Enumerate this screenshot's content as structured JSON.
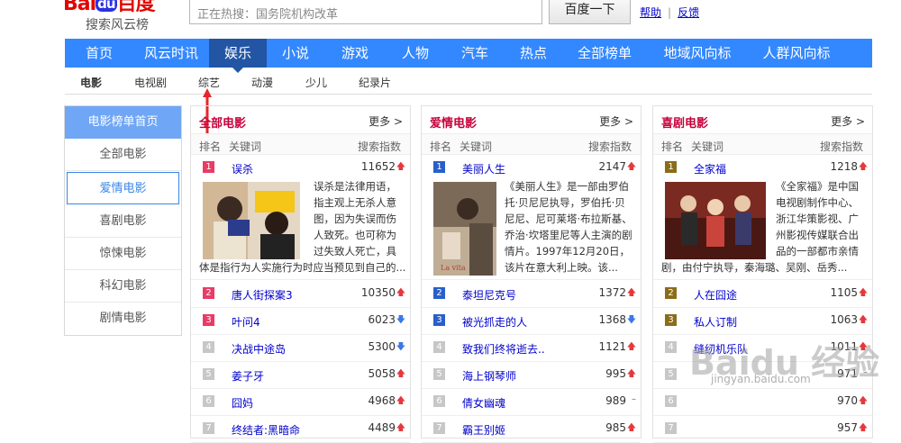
{
  "header": {
    "logo_main": "Bai",
    "logo_du": "du",
    "logo_cn": "百度",
    "logo_sub": "搜索风云榜",
    "search_placeholder": "正在热搜：国务院机构改革",
    "search_button": "百度一下",
    "help_link": "帮助",
    "feedback_link": "反馈"
  },
  "nav": {
    "items": [
      "首页",
      "风云时讯",
      "娱乐",
      "小说",
      "游戏",
      "人物",
      "汽车",
      "热点",
      "全部榜单",
      "地域风向标",
      "人群风向标"
    ],
    "active": "娱乐"
  },
  "subnav": {
    "items": [
      "电影",
      "电视剧",
      "综艺",
      "动漫",
      "少儿",
      "纪录片"
    ],
    "active": "电影"
  },
  "sidebar": {
    "header": "电影榜单首页",
    "items": [
      "全部电影",
      "爱情电影",
      "喜剧电影",
      "惊悚电影",
      "科幻电影",
      "剧情电影"
    ],
    "selected": "爱情电影"
  },
  "columns": {
    "rank": "排名",
    "keyword": "关键词",
    "index": "搜索指数",
    "more": "更多 >"
  },
  "panels": [
    {
      "title": "全部电影",
      "featured": {
        "rank": "1",
        "name": "误杀",
        "value": "11652",
        "trend": "up",
        "desc": "误杀是法律用语，指主观上无杀人意图，因为失误而伤人致死。也可称为过失致人死亡，具",
        "desc2": "体是指行为人实施行为时应当预见到自己的..."
      },
      "rows": [
        {
          "rank": "2",
          "name": "唐人街探案3",
          "value": "10350",
          "trend": "up"
        },
        {
          "rank": "3",
          "name": "叶问4",
          "value": "6023",
          "trend": "down"
        },
        {
          "rank": "4",
          "name": "决战中途岛",
          "value": "5300",
          "trend": "down"
        },
        {
          "rank": "5",
          "name": "姜子牙",
          "value": "5058",
          "trend": "up"
        },
        {
          "rank": "6",
          "name": "囧妈",
          "value": "4968",
          "trend": "up"
        },
        {
          "rank": "7",
          "name": "终结者:黑暗命",
          "value": "4489",
          "trend": "up"
        }
      ]
    },
    {
      "title": "爱情电影",
      "featured": {
        "rank": "1",
        "name": "美丽人生",
        "value": "2147",
        "trend": "up",
        "desc": "《美丽人生》是一部由罗伯托·贝尼尼执导，罗伯托·贝尼尼、尼可莱塔·布拉斯基、乔治·坎塔里尼等人主演的剧情片。1997年12月20日，该片在意大利上映。该...",
        "desc2": ""
      },
      "rows": [
        {
          "rank": "2",
          "name": "泰坦尼克号",
          "value": "1372",
          "trend": "up"
        },
        {
          "rank": "3",
          "name": "被光抓走的人",
          "value": "1368",
          "trend": "down"
        },
        {
          "rank": "4",
          "name": "致我们终将逝去..",
          "value": "1121",
          "trend": "up"
        },
        {
          "rank": "5",
          "name": "海上钢琴师",
          "value": "995",
          "trend": "up"
        },
        {
          "rank": "6",
          "name": "倩女幽魂",
          "value": "989",
          "trend": "flat"
        },
        {
          "rank": "7",
          "name": "霸王别姬",
          "value": "985",
          "trend": "up"
        }
      ]
    },
    {
      "title": "喜剧电影",
      "featured": {
        "rank": "1",
        "name": "全家福",
        "value": "1218",
        "trend": "up",
        "desc": "《全家福》是中国电视剧制作中心、浙江华策影视、广州影视传媒联合出品的一部都市亲情",
        "desc2": "剧，由付宁执导，秦海璐、吴刚、岳秀..."
      },
      "rows": [
        {
          "rank": "2",
          "name": "人在囧途",
          "value": "1105",
          "trend": "up"
        },
        {
          "rank": "3",
          "name": "私人订制",
          "value": "1063",
          "trend": "up"
        },
        {
          "rank": "4",
          "name": "缝纫机乐队",
          "value": "1011",
          "trend": "up"
        },
        {
          "rank": "5",
          "name": "",
          "value": "971",
          "trend": "flat"
        },
        {
          "rank": "6",
          "name": "",
          "value": "970",
          "trend": "up"
        },
        {
          "rank": "7",
          "name": "",
          "value": "957",
          "trend": "up"
        }
      ]
    }
  ],
  "watermark": {
    "text": "Baidu 经验",
    "url": "jingyan.baidu.com"
  },
  "colors": {
    "nav": "#3388ff",
    "nav_active": "#2255a4",
    "title": "#c6003a",
    "link": "#0000cc",
    "rank_top": "#ea3b66"
  }
}
